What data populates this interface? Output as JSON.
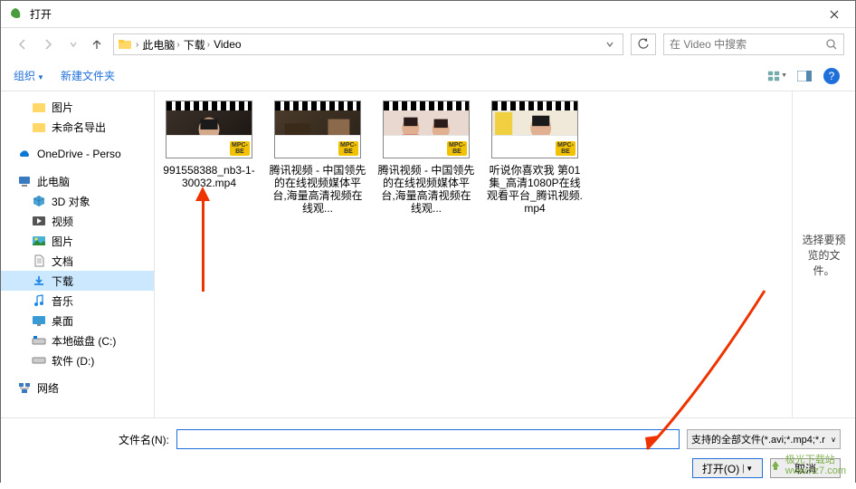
{
  "title": "打开",
  "breadcrumb": {
    "pc": "此电脑",
    "dl": "下载",
    "video": "Video"
  },
  "search": {
    "placeholder": "在 Video 中搜索"
  },
  "toolbar": {
    "organize": "组织",
    "newfolder": "新建文件夹"
  },
  "tree": {
    "pictures": "图片",
    "unnamed": "未命名导出",
    "onedrive": "OneDrive - Perso",
    "thispc": "此电脑",
    "objects3d": "3D 对象",
    "videos": "视频",
    "pics": "图片",
    "docs": "文档",
    "downloads": "下载",
    "music": "音乐",
    "desktop": "桌面",
    "diskc": "本地磁盘 (C:)",
    "diskd": "软件 (D:)",
    "network": "网络"
  },
  "files": [
    {
      "name": "991558388_nb3-1-30032.mp4"
    },
    {
      "name": "腾讯视频 - 中国领先的在线视频媒体平台,海量高清视频在线观..."
    },
    {
      "name": "腾讯视频 - 中国领先的在线视频媒体平台,海量高清视频在线观..."
    },
    {
      "name": "听说你喜欢我 第01集_高清1080P在线观看平台_腾讯视频.mp4"
    }
  ],
  "preview": "选择要预览的文件。",
  "filerow": {
    "label": "文件名(N):",
    "value": ""
  },
  "filter": "支持的全部文件(*.avi;*.mp4;*.r",
  "buttons": {
    "open": "打开(O)",
    "cancel": "取消"
  },
  "watermark": "极光下载站\nwww.xz7.com"
}
